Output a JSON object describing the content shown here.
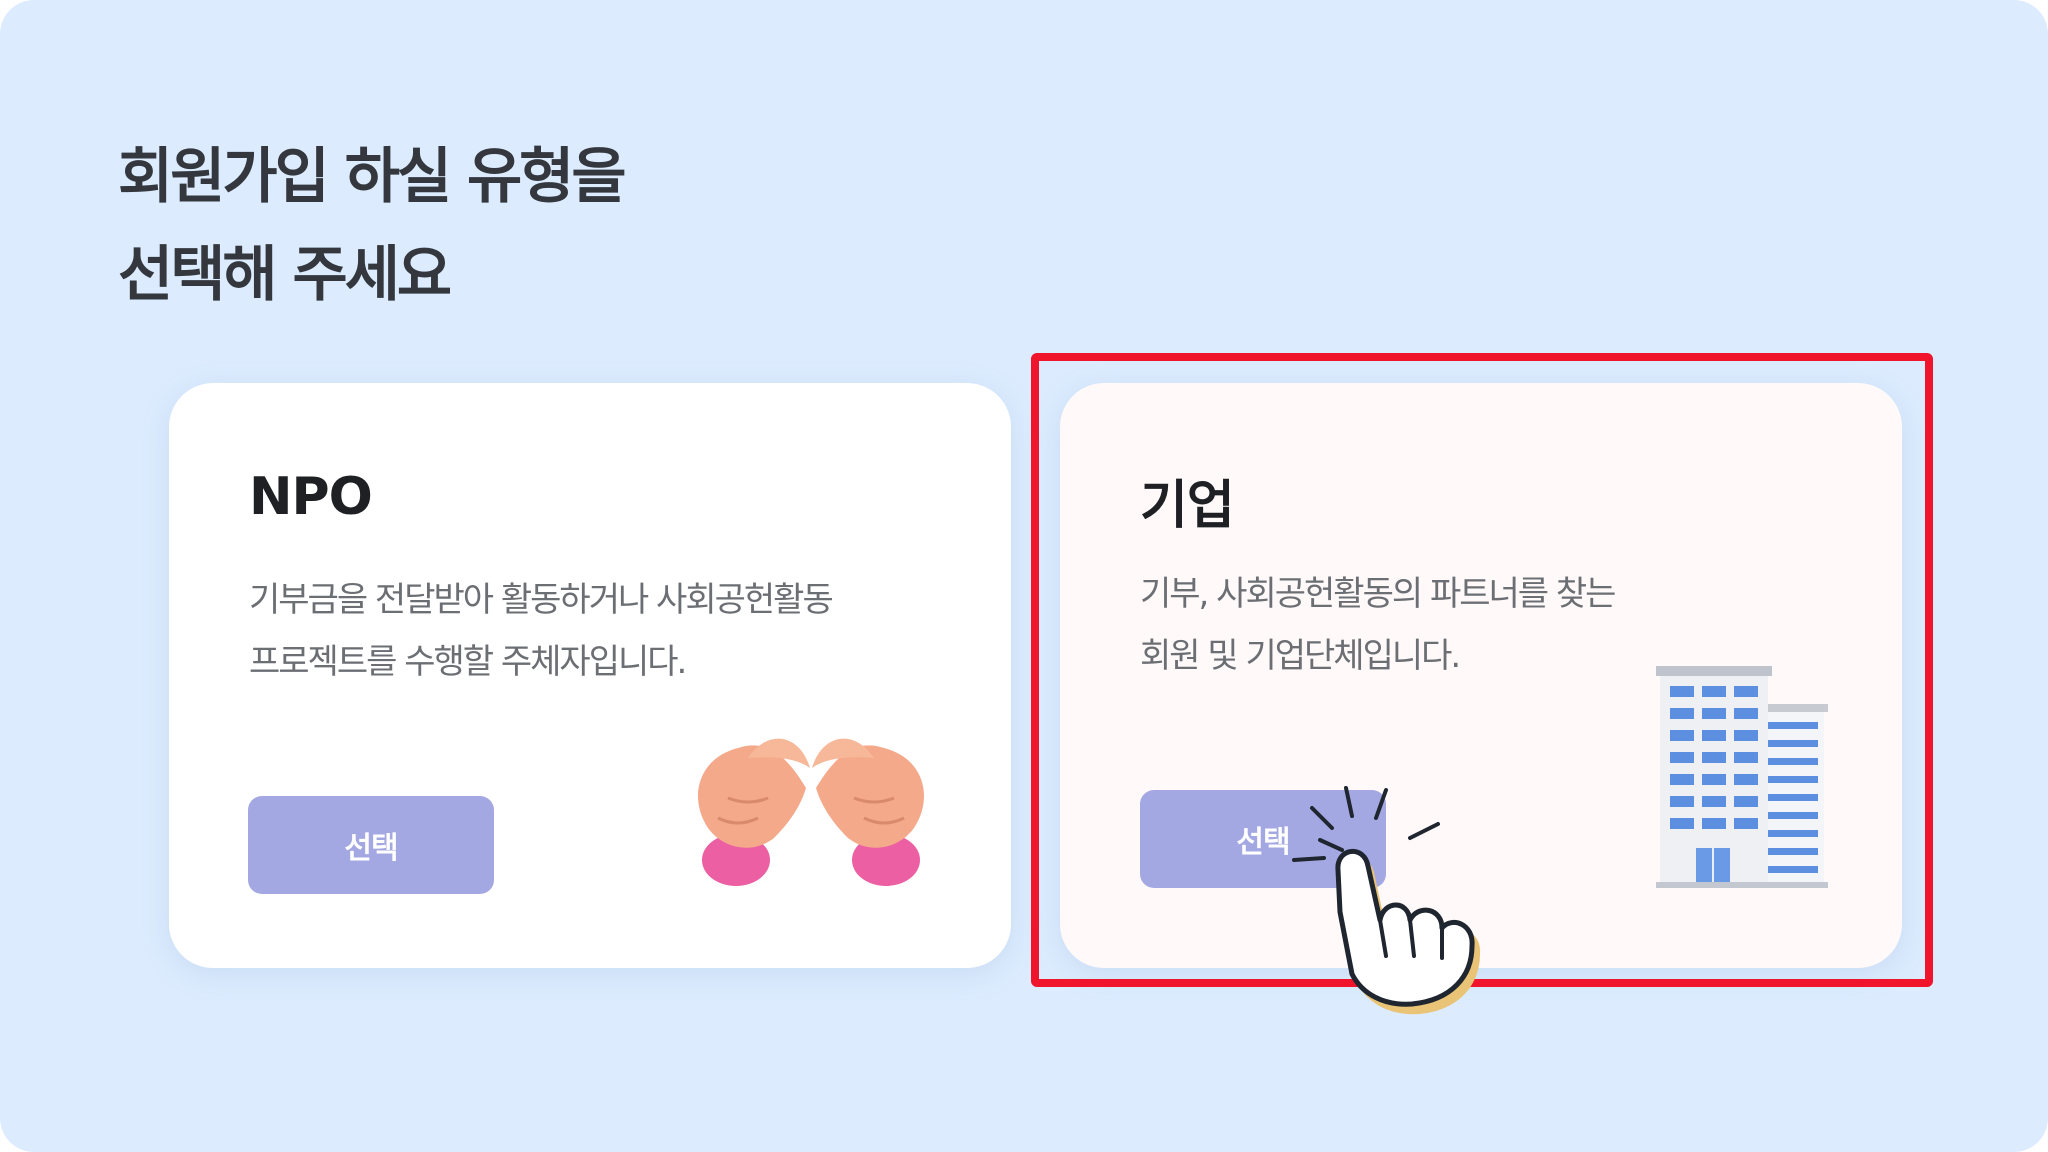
{
  "heading": {
    "line1": "회원가입 하실 유형을",
    "line2": "선택해 주세요"
  },
  "cards": [
    {
      "title": "NPO",
      "description": [
        "기부금을 전달받아 활동하거나 사회공헌활동",
        "프로젝트를 수행할 주체자입니다."
      ],
      "button_label": "선택",
      "icon": "heart-hands-icon"
    },
    {
      "title": "기업",
      "description": [
        "기부, 사회공헌활동의 파트너를 찾는",
        "회원 및 기업단체입니다."
      ],
      "button_label": "선택",
      "icon": "office-building-icon",
      "selected": true
    }
  ],
  "overlay": {
    "pointer_icon": "tapping-hand-cursor-icon"
  },
  "colors": {
    "background": "#dcecfe",
    "card_npo": "#ffffff",
    "card_corp": "#fff9f9",
    "button": "#a4a8e2",
    "highlight": "#f0142c",
    "heading_text": "#34383e",
    "body_text": "#6b6e73"
  }
}
